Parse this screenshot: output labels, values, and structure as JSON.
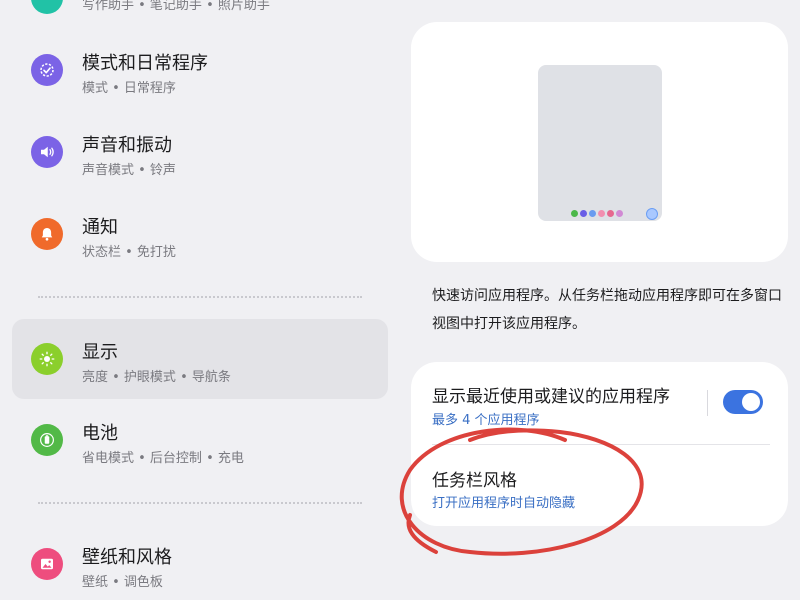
{
  "settings": {
    "top_partial": {
      "subtitle": "写作助手 • 笔记助手 • 照片助手",
      "icon": "assistant-icon",
      "color": "#21c2a6"
    },
    "items": [
      {
        "title": "模式和日常程序",
        "subtitle": "模式 • 日常程序",
        "icon": "routine-check-icon",
        "color": "#7b63e6"
      },
      {
        "title": "声音和振动",
        "subtitle": "声音模式 • 铃声",
        "icon": "speaker-icon",
        "color": "#7b63e6"
      },
      {
        "title": "通知",
        "subtitle": "状态栏 • 免打扰",
        "icon": "bell-icon",
        "color": "#f06a2b"
      },
      {
        "title": "显示",
        "subtitle": "亮度 • 护眼模式 • 导航条",
        "icon": "sun-icon",
        "color": "#8bcf2c",
        "active": true
      },
      {
        "title": "电池",
        "subtitle": "省电模式 • 后台控制 • 充电",
        "icon": "battery-icon",
        "color": "#52b947"
      },
      {
        "title": "壁纸和风格",
        "subtitle": "壁纸 • 调色板",
        "icon": "image-icon",
        "color": "#ee4d7e"
      }
    ]
  },
  "taskbar": {
    "description": "快速访问应用程序。从任务栏拖动应用程序即可在多窗口视图中打开该应用程序。",
    "preview": {
      "dock_colors": [
        "#4cb84a",
        "#6a5ee6",
        "#6a9cf0",
        "#f28fb0",
        "#e6688f",
        "#d18ad4"
      ]
    },
    "options": [
      {
        "title": "显示最近使用或建议的应用程序",
        "subtitle": "最多 4 个应用程序",
        "toggle_on": true
      },
      {
        "title": "任务栏风格",
        "subtitle": "打开应用程序时自动隐藏"
      }
    ]
  },
  "colors": {
    "accent": "#3b73e0",
    "annotation": "#d9322b"
  }
}
